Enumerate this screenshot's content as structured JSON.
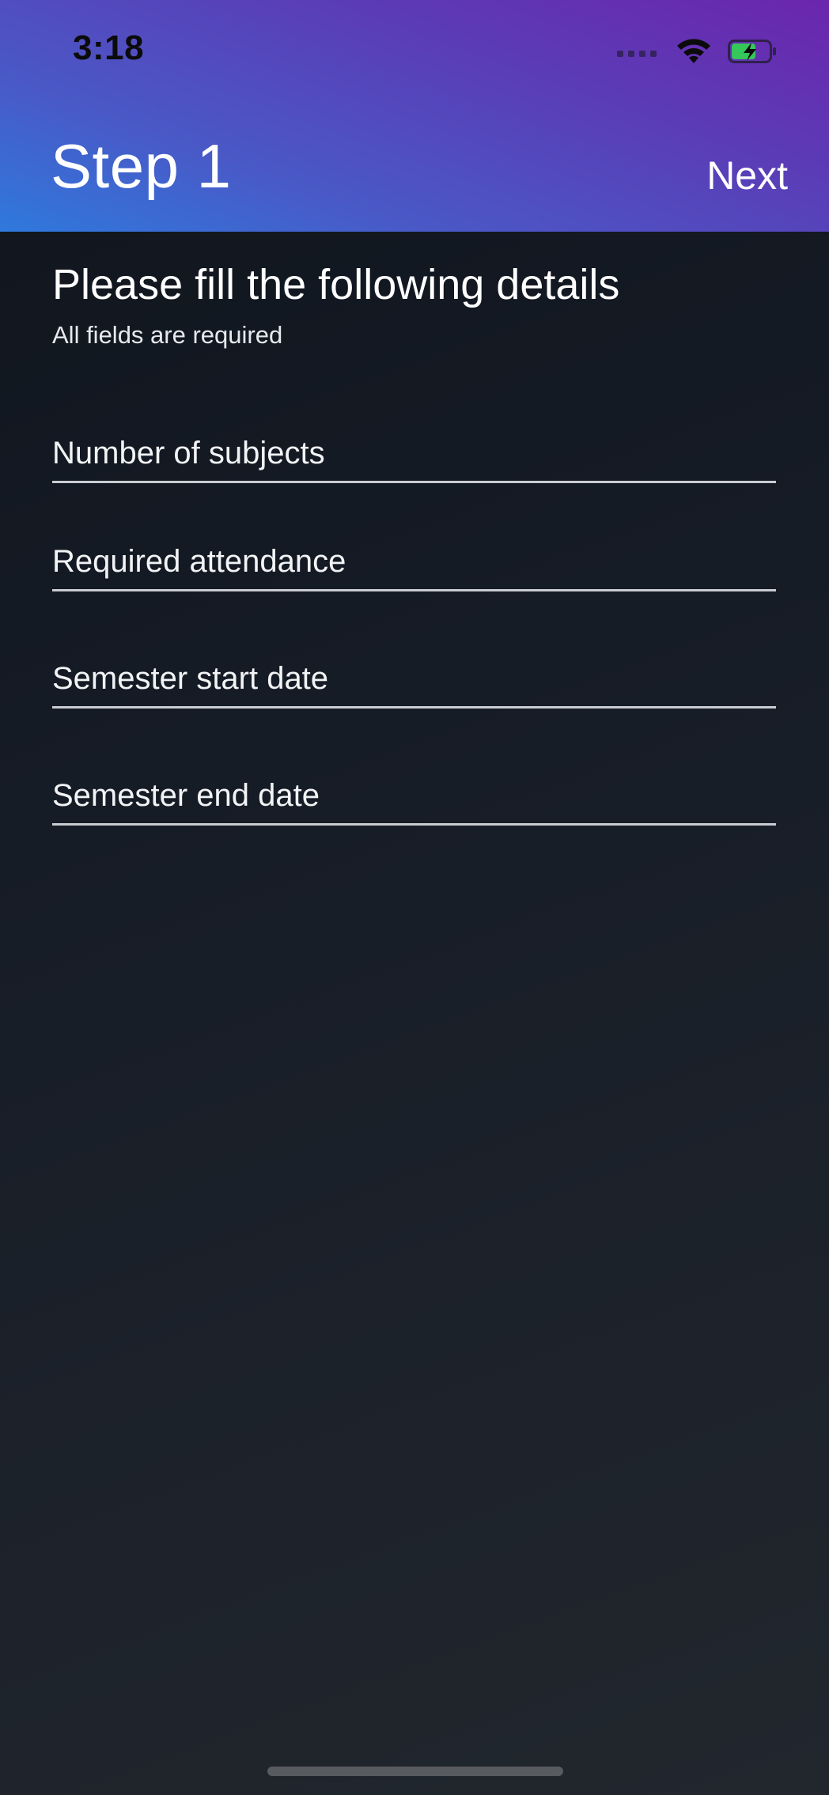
{
  "status_bar": {
    "time": "3:18",
    "icons": [
      "signal-icon",
      "wifi-icon",
      "battery-charging-icon"
    ]
  },
  "header": {
    "title": "Step 1",
    "next_label": "Next"
  },
  "form": {
    "heading": "Please fill the following details",
    "subheading": "All fields are required",
    "fields": [
      {
        "placeholder": "Number of subjects",
        "value": ""
      },
      {
        "placeholder": "Required attendance",
        "value": ""
      },
      {
        "placeholder": "Semester start date",
        "value": ""
      },
      {
        "placeholder": "Semester end date",
        "value": ""
      }
    ]
  },
  "colors": {
    "header_gradient_start": "#2f79dd",
    "header_gradient_end": "#6b26ad",
    "background": "#161c26",
    "battery_green": "#34c759"
  }
}
